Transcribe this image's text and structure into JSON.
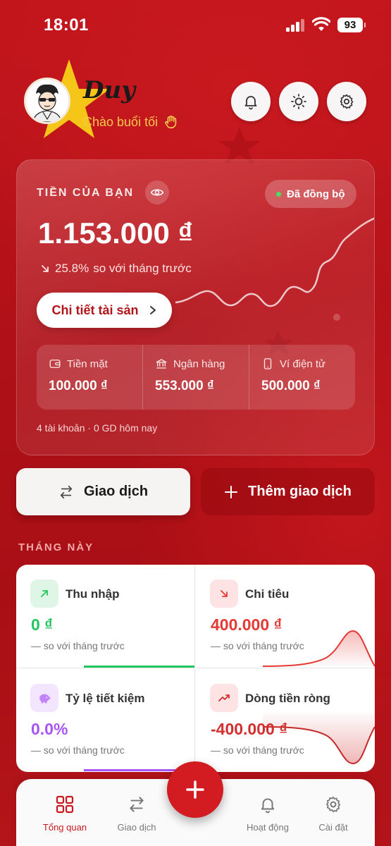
{
  "status_bar": {
    "time": "18:01",
    "battery": "93"
  },
  "header": {
    "user_name": "Duy",
    "greeting": "Chào buổi tối",
    "greeting_icon": "hand-wave-icon",
    "buttons": [
      "bell-icon",
      "sun-icon",
      "gear-icon"
    ]
  },
  "balance_card": {
    "label": "TIỀN CỦA BẠN",
    "sync_status": "Đã đồng bộ",
    "amount": "1.153.000 ₫",
    "change_percent": "25.8%",
    "change_text": "so với tháng trước",
    "trend": "down",
    "detail_button": "Chi tiết tài sản",
    "wallets": [
      {
        "label": "Tiền mặt",
        "amount": "100.000 ₫",
        "icon": "wallet-icon"
      },
      {
        "label": "Ngân hàng",
        "amount": "553.000 ₫",
        "icon": "bank-icon"
      },
      {
        "label": "Ví điện tử",
        "amount": "500.000 ₫",
        "icon": "phone-icon"
      }
    ],
    "footer": "4 tài khoản · 0 GD hôm nay"
  },
  "actions": {
    "transactions": "Giao dịch",
    "add_transaction": "Thêm giao dịch"
  },
  "this_month": {
    "title": "THÁNG NÀY",
    "stats": [
      {
        "label": "Thu nhập",
        "value": "0 ₫",
        "compare": "— so với tháng trước",
        "color": "#22c55e"
      },
      {
        "label": "Chi tiêu",
        "value": "400.000 ₫",
        "compare": "— so với tháng trước",
        "color": "#e53935"
      },
      {
        "label": "Tỷ lệ tiết kiệm",
        "value": "0.0%",
        "compare": "— so với tháng trước",
        "color": "#a855f7"
      },
      {
        "label": "Dòng tiền ròng",
        "value": "-400.000 ₫",
        "compare": "— so với tháng trước",
        "color": "#d32f2f"
      }
    ]
  },
  "bottom_nav": {
    "items": [
      {
        "label": "Tổng quan",
        "icon": "grid-icon",
        "active": true
      },
      {
        "label": "Giao dịch",
        "icon": "swap-icon",
        "active": false
      },
      {
        "label": "Hoạt động",
        "icon": "bell-icon",
        "active": false
      },
      {
        "label": "Cài đặt",
        "icon": "gear-icon",
        "active": false
      }
    ],
    "fab_icon": "plus-icon"
  }
}
